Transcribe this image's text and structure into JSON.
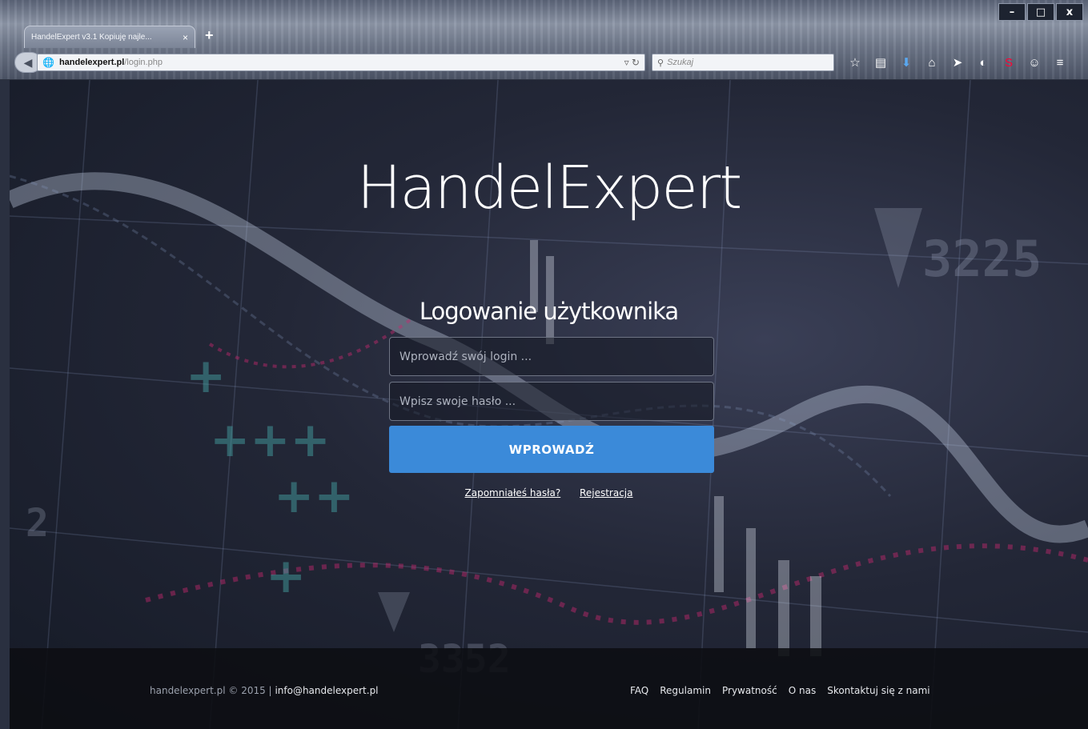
{
  "browser": {
    "tab_title": "HandelExpert v3.1 Kopiuję najle...",
    "tab_close": "×",
    "new_tab": "+",
    "url_domain": "handelexpert.pl",
    "url_path": "/login.php",
    "search_placeholder": "Szukaj",
    "window_buttons": [
      "–",
      "□",
      "x"
    ]
  },
  "page": {
    "logo": "HandelExpert",
    "login_title": "Logowanie użytkownika",
    "login_placeholder": "Wprowadź swój login ...",
    "password_placeholder": "Wpisz swoje hasło ...",
    "submit_label": "WPROWADŹ",
    "forgot_link": "Zapomniałeś hasła?",
    "register_link": "Rejestracja",
    "bg_numbers": [
      "3225",
      "3352",
      "2"
    ]
  },
  "footer": {
    "copyright": "handelexpert.pl © 2015 |",
    "email": "info@handelexpert.pl",
    "nav": [
      "FAQ",
      "Regulamin",
      "Prywatność",
      "O nas",
      "Skontaktuj się z nami"
    ]
  },
  "colors": {
    "accent": "#3b8ad9"
  }
}
